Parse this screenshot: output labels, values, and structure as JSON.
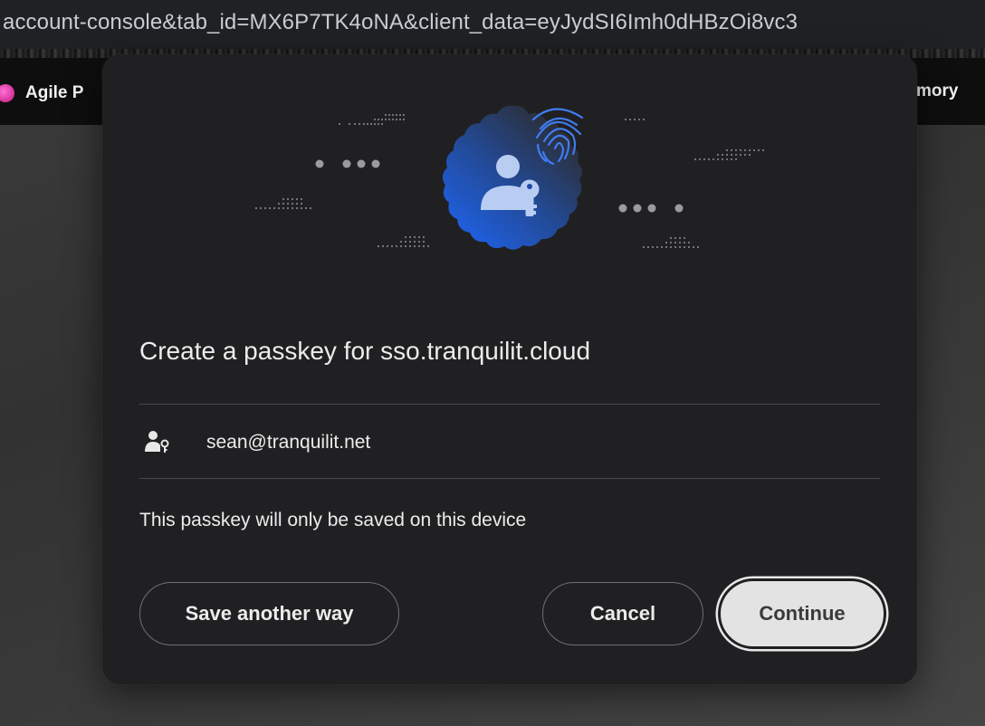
{
  "browser": {
    "url_fragment": "account-console&tab_id=MX6P7TK4oNA&client_data=eyJydSI6Imh0dHBzOi8vc3",
    "bookmark_left_label": "Agile P",
    "bookmark_right_label": "mory"
  },
  "dialog": {
    "title": "Create a passkey for sso.tranquilit.cloud",
    "account_email": "sean@tranquilit.net",
    "note": "This passkey will only be saved on this device",
    "buttons": {
      "save_another_way": "Save another way",
      "cancel": "Cancel",
      "continue": "Continue"
    }
  },
  "colors": {
    "dialog_background": "#202022",
    "accent_blue": "#2f6fe0",
    "continue_button": "#e3e3e3"
  },
  "icons": {
    "hero": "passkey-badge-icon",
    "fingerprint": "fingerprint-icon",
    "account": "person-key-icon"
  }
}
